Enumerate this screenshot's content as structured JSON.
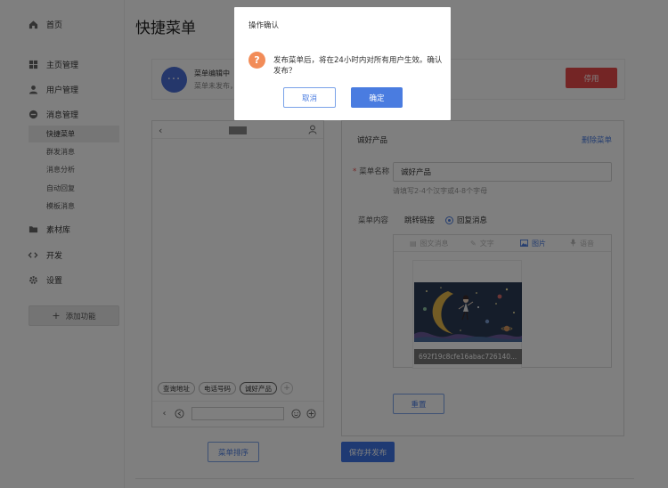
{
  "sidebar": {
    "home": {
      "label": "首页",
      "icon": "home-icon"
    },
    "homepage_mgmt": {
      "label": "主页管理",
      "icon": "grid-icon"
    },
    "user_mgmt": {
      "label": "用户管理",
      "icon": "user-icon"
    },
    "message_mgmt": {
      "label": "消息管理",
      "icon": "message-icon"
    },
    "message_sub": [
      "快捷菜单",
      "群发消息",
      "消息分析",
      "自动回复",
      "模板消息"
    ],
    "material": {
      "label": "素材库",
      "icon": "folder-icon"
    },
    "dev": {
      "label": "开发",
      "icon": "code-icon"
    },
    "settings": {
      "label": "设置",
      "icon": "gear-icon"
    },
    "add_function": "添加功能"
  },
  "page": {
    "title": "快捷菜单"
  },
  "status": {
    "name": "菜单编辑中",
    "sub": "菜单未发布，",
    "disable_button": "停用",
    "avatar": "···"
  },
  "phone": {
    "quick_menus": [
      "查询地址",
      "电话号码",
      "诚好产品"
    ],
    "add": "+"
  },
  "editor": {
    "menu_title": "诚好产品",
    "delete_label": "删除菜单",
    "name_label": "菜单名称",
    "name_value": "诚好产品",
    "name_hint": "请填写2-4个汉字或4-8个字母",
    "content_label": "菜单内容",
    "radio_jump": "跳转链接",
    "radio_reply": "回复消息",
    "tabs": [
      "图文消息",
      "文字",
      "图片",
      "语音"
    ],
    "active_tab": "图片",
    "image_caption": "692f19c8cfe16abac726140...",
    "reset_button": "重置"
  },
  "actions": {
    "sort_button": "菜单排序",
    "publish_button": "保存并发布"
  },
  "dialog": {
    "title": "操作确认",
    "message": "发布菜单后，将在24小时内对所有用户生效。确认发布？",
    "cancel": "取消",
    "confirm": "确定",
    "icon_text": "?"
  },
  "colors": {
    "primary": "#4a7ce0",
    "danger": "#e94b4b",
    "warning": "#f28c58",
    "avatar": "#4a6fd6"
  }
}
